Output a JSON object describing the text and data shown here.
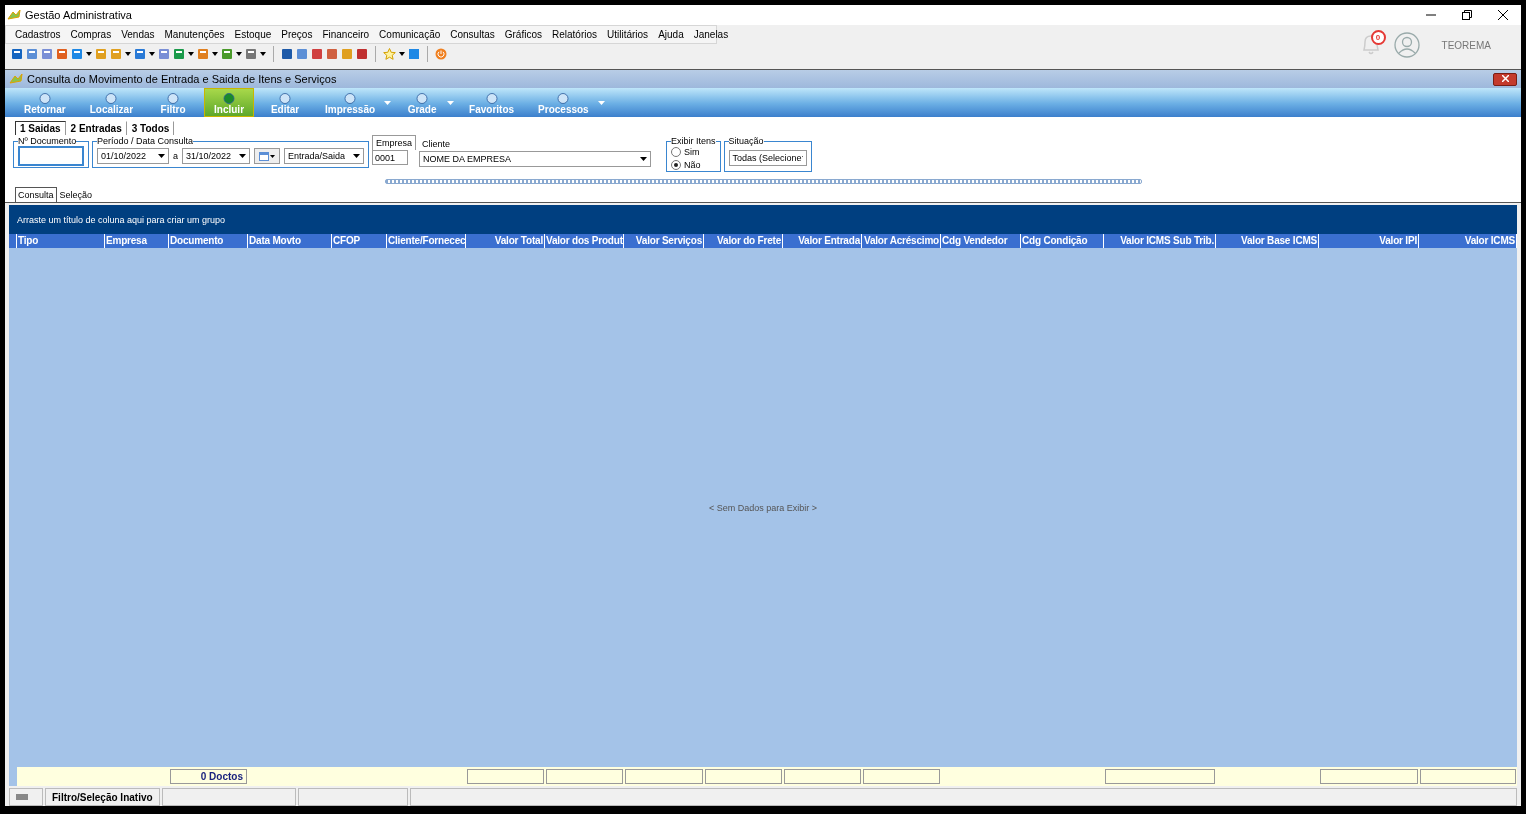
{
  "window": {
    "title": "Gestão Administrativa"
  },
  "menu": [
    "Cadastros",
    "Compras",
    "Vendas",
    "Manutenções",
    "Estoque",
    "Preços",
    "Financeiro",
    "Comunicação",
    "Consultas",
    "Gráficos",
    "Relatórios",
    "Utilitários",
    "Ajuda",
    "Janelas"
  ],
  "header": {
    "notifications": "0",
    "user": "TEOREMA"
  },
  "form": {
    "title": "Consulta do Movimento de Entrada e Saida de Itens e Serviços"
  },
  "ribbon": [
    {
      "label": "Retornar",
      "selected": false,
      "dropdown": false
    },
    {
      "label": "Localizar",
      "selected": false,
      "dropdown": false
    },
    {
      "label": "Filtro",
      "selected": false,
      "dropdown": false
    },
    {
      "label": "Incluir",
      "selected": true,
      "dropdown": false
    },
    {
      "label": "Editar",
      "selected": false,
      "dropdown": false
    },
    {
      "label": "Impressão",
      "selected": false,
      "dropdown": true
    },
    {
      "label": "Grade",
      "selected": false,
      "dropdown": true
    },
    {
      "label": "Favoritos",
      "selected": false,
      "dropdown": false
    },
    {
      "label": "Processos",
      "selected": false,
      "dropdown": true
    }
  ],
  "tabs": [
    {
      "label": "1 Saidas",
      "selected": true
    },
    {
      "label": "2 Entradas",
      "selected": false
    },
    {
      "label": "3 Todos",
      "selected": false
    }
  ],
  "filters": {
    "document": {
      "label": "Nº Documento"
    },
    "period": {
      "label": "Período / Data Consulta",
      "from": "01/10/2022",
      "separator": "a",
      "to": "31/10/2022",
      "type": "Entrada/Saida"
    },
    "company": {
      "label": "Empresa",
      "value": "0001"
    },
    "client": {
      "label": "Cliente",
      "value": "NOME DA EMPRESA"
    },
    "show_items": {
      "label": "Exibir Itens",
      "options": [
        {
          "label": "Sim",
          "selected": false
        },
        {
          "label": "Não",
          "selected": true
        }
      ]
    },
    "status": {
      "label": "Situação",
      "value": "Todas (Selecione"
    }
  },
  "subtabs": [
    {
      "label": "Consulta",
      "selected": true
    },
    {
      "label": "Seleção",
      "selected": false
    }
  ],
  "grid": {
    "group_hint": "Arraste um título de coluna aqui para criar um grupo",
    "columns": [
      {
        "label": "Tipo",
        "kind": "text",
        "summary": false
      },
      {
        "label": "Empresa",
        "kind": "text",
        "summary": false
      },
      {
        "label": "Documento",
        "kind": "text",
        "summary": true,
        "total": "0 Doctos"
      },
      {
        "label": "Data Movto",
        "kind": "text",
        "summary": false
      },
      {
        "label": "CFOP",
        "kind": "text",
        "summary": false
      },
      {
        "label": "Cliente/Fornecec",
        "kind": "text",
        "summary": false
      },
      {
        "label": "Valor Total",
        "kind": "amount",
        "summary": true
      },
      {
        "label": "Valor dos Produt",
        "kind": "amount",
        "summary": true
      },
      {
        "label": "Valor Serviços",
        "kind": "amount",
        "summary": true
      },
      {
        "label": "Valor do Frete",
        "kind": "amount",
        "summary": true
      },
      {
        "label": "Valor Entrada",
        "kind": "amount",
        "summary": true
      },
      {
        "label": "Valor Acréscimo",
        "kind": "amount",
        "summary": true
      },
      {
        "label": "Cdg Vendedor",
        "kind": "text",
        "summary": false
      },
      {
        "label": "Cdg Condição",
        "kind": "text",
        "summary": false
      },
      {
        "label": "Valor ICMS Sub Trib.",
        "kind": "amount",
        "summary": true
      },
      {
        "label": "Valor Base ICMS",
        "kind": "amount",
        "summary": false
      },
      {
        "label": "Valor IPI",
        "kind": "amount",
        "summary": true
      },
      {
        "label": "Valor ICMS",
        "kind": "amount",
        "summary": true
      }
    ],
    "empty_text": "< Sem Dados para Exibir >"
  },
  "status_bar": {
    "filter": "Filtro/Seleção Inativo"
  }
}
